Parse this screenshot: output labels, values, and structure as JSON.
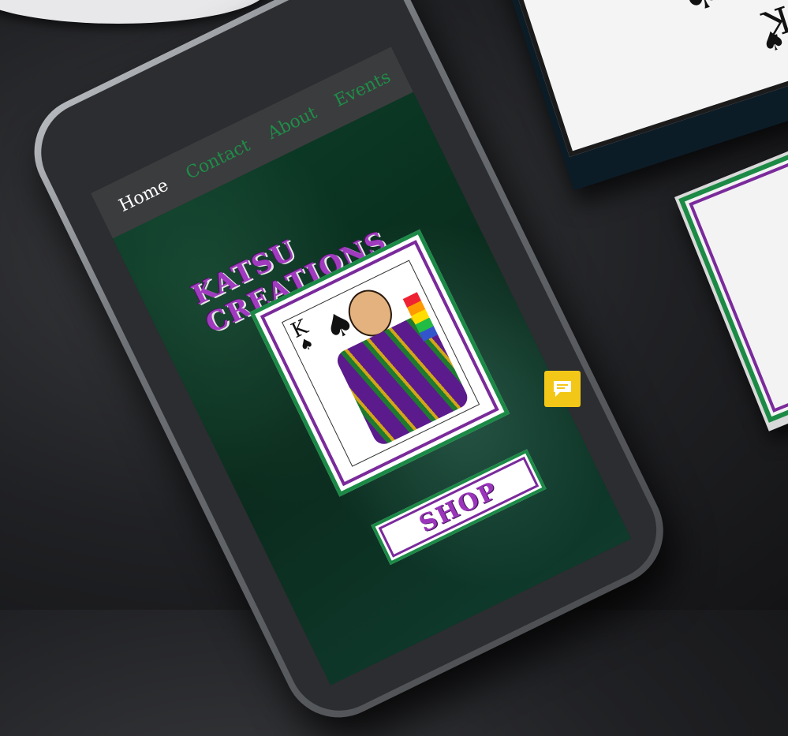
{
  "nav": {
    "home": "Home",
    "contact": "Contact",
    "about": "About",
    "events": "Events"
  },
  "brand": "KATSU CREATIONS",
  "hero_card": {
    "rank": "K",
    "suit": "♠"
  },
  "shop_label": "SHOP",
  "background_cards": {
    "rank": "K",
    "suit": "♠"
  },
  "colors": {
    "green": "#1b8a46",
    "purple": "#7a2a9b",
    "velvet": "#0d2b1d",
    "nav_bg": "#3b3c3e",
    "chat": "#f3c718"
  },
  "icons": {
    "chat": "chat-bubble-icon"
  }
}
